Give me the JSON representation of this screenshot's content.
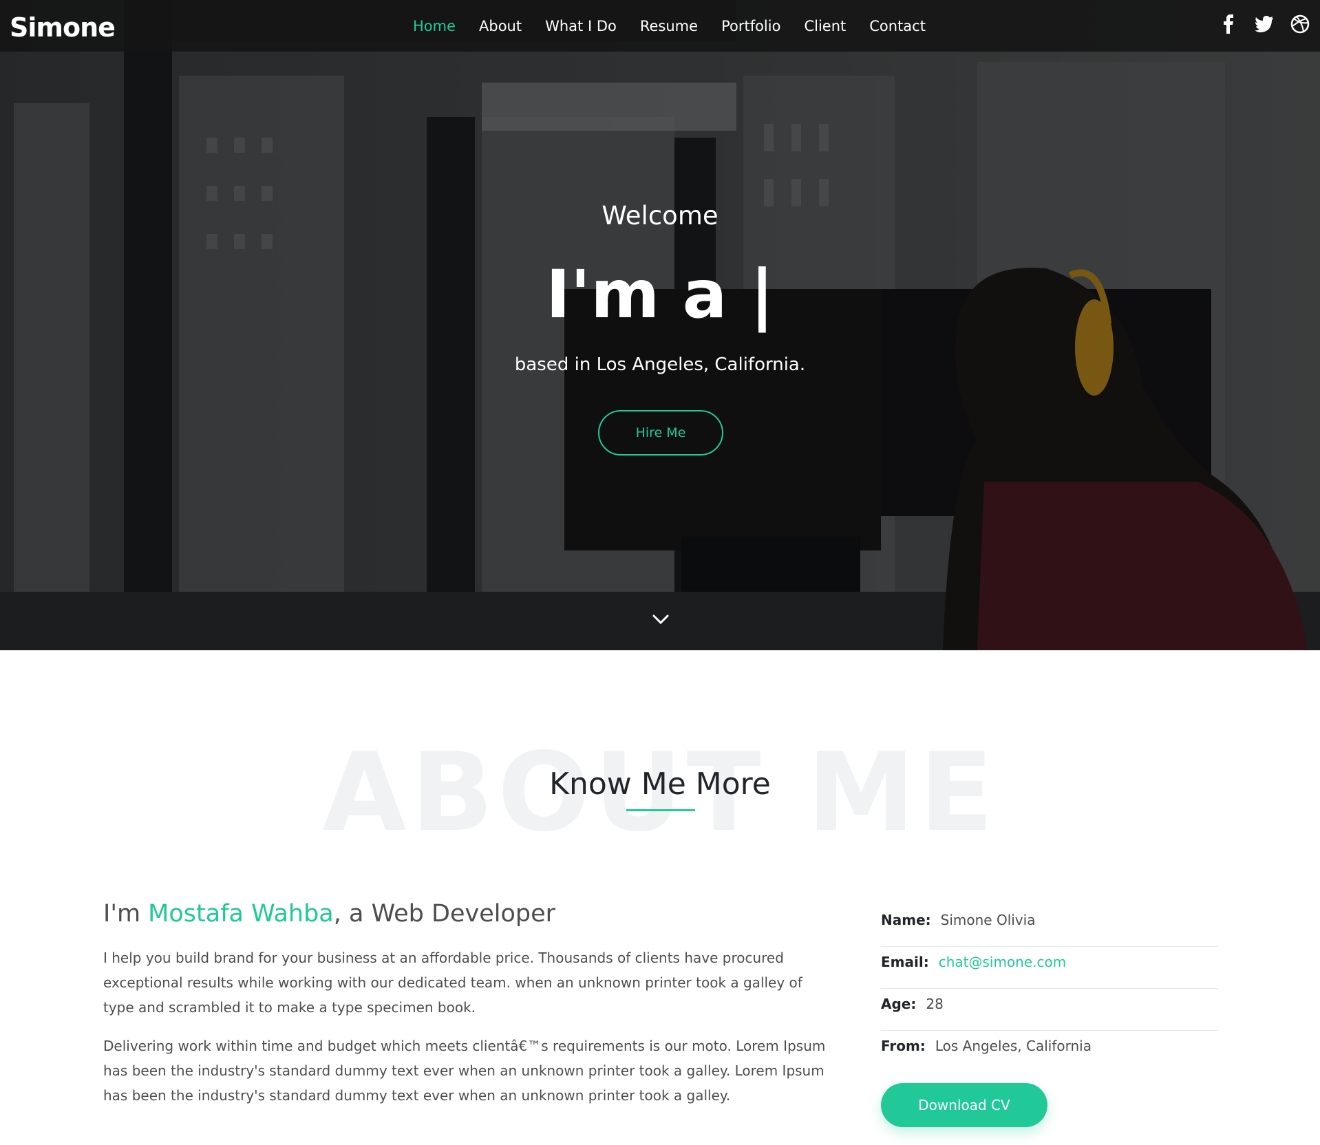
{
  "header": {
    "logo": "Simone",
    "nav": [
      {
        "label": "Home",
        "active": true
      },
      {
        "label": "About",
        "active": false
      },
      {
        "label": "What I Do",
        "active": false
      },
      {
        "label": "Resume",
        "active": false
      },
      {
        "label": "Portfolio",
        "active": false
      },
      {
        "label": "Client",
        "active": false
      },
      {
        "label": "Contact",
        "active": false
      }
    ],
    "social": [
      "facebook-icon",
      "twitter-icon",
      "dribbble-icon"
    ]
  },
  "hero": {
    "welcome": "Welcome",
    "headline": "I'm a |",
    "subtitle": "based in Los Angeles, California.",
    "hire_label": "Hire Me"
  },
  "about": {
    "bg_text": "ABOUT ME",
    "title": "Know Me More",
    "intro_prefix": "I'm ",
    "intro_name": "Mostafa Wahba",
    "intro_suffix": ", a Web Developer",
    "para1": "I help you build brand for your business at an affordable price. Thousands of clients have procured exceptional results while working with our dedicated team. when an unknown printer took a galley of type and scrambled it to make a type specimen book.",
    "para2": "Delivering work within time and budget which meets clientâ€™s requirements is our moto. Lorem Ipsum has been the industry's standard dummy text ever when an unknown printer took a galley. Lorem Ipsum has been the industry's standard dummy text ever when an unknown printer took a galley.",
    "info": {
      "name_label": "Name:",
      "name": "Simone Olivia",
      "email_label": "Email:",
      "email": "chat@simone.com",
      "age_label": "Age:",
      "age": "28",
      "from_label": "From:",
      "from": "Los Angeles, California"
    },
    "download_label": "Download CV"
  },
  "colors": {
    "accent": "#20c997",
    "header_bg": "#141414",
    "text": "#4c4d4d",
    "heading": "#212529"
  }
}
